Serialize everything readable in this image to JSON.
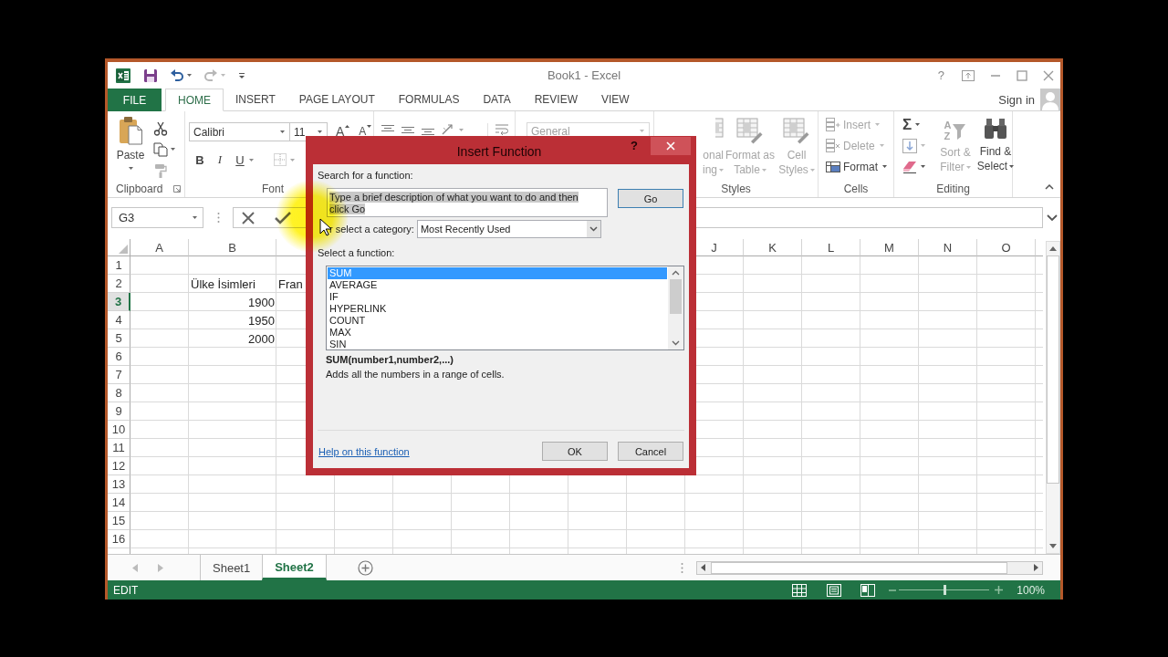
{
  "window": {
    "title": "Book1 - Excel",
    "help": "?"
  },
  "quick_access": [
    {
      "disabled": false
    },
    {
      "disabled": true
    }
  ],
  "tabs": [
    {
      "label": "FILE",
      "kind": "file",
      "selected": false
    },
    {
      "label": "HOME",
      "kind": "tab",
      "selected": true
    },
    {
      "label": "INSERT",
      "kind": "tab",
      "selected": false
    },
    {
      "label": "PAGE LAYOUT",
      "kind": "tab",
      "selected": false
    },
    {
      "label": "FORMULAS",
      "kind": "tab",
      "selected": false
    },
    {
      "label": "DATA",
      "kind": "tab",
      "selected": false
    },
    {
      "label": "REVIEW",
      "kind": "tab",
      "selected": false
    },
    {
      "label": "VIEW",
      "kind": "tab",
      "selected": false
    }
  ],
  "account": {
    "label": "Sign in"
  },
  "ribbon": {
    "clipboard": {
      "label": "Clipboard",
      "paste": "Paste",
      "small_buttons": [
        {
          "disabled": false
        },
        {
          "disabled": false
        },
        {
          "disabled": true
        }
      ]
    },
    "font": {
      "label": "Font",
      "font_name": "Calibri",
      "font_size": "11",
      "size_buttons": [
        "A",
        "A"
      ],
      "style_buttons": [
        "B",
        "I",
        "U"
      ]
    },
    "number": {
      "format": "General",
      "disabled": true
    },
    "styles": {
      "label": "Styles",
      "buttons": [
        {
          "kind": "partial",
          "lines": [
            "onal",
            "ing"
          ],
          "disabled": true
        },
        {
          "kind": "large",
          "lines": [
            "Format as",
            "Table"
          ],
          "disabled": true
        },
        {
          "kind": "large",
          "lines": [
            "Cell",
            "Styles"
          ],
          "disabled": true
        }
      ]
    },
    "cells": {
      "label": "Cells",
      "buttons": [
        {
          "label": "Insert",
          "disabled": true
        },
        {
          "label": "Delete",
          "disabled": true
        },
        {
          "label": "Format",
          "disabled": false
        }
      ]
    },
    "editing": {
      "label": "Editing",
      "small_buttons": [
        {
          "symbol": "Σ",
          "disabled": false
        },
        {
          "disabled": true
        },
        {
          "disabled": false
        }
      ],
      "sort_letters": [
        "A",
        "Z"
      ],
      "buttons": [
        {
          "lines": [
            "Sort &",
            "Filter"
          ],
          "disabled": true
        },
        {
          "lines": [
            "Find &",
            "Select"
          ],
          "disabled": false
        }
      ]
    }
  },
  "formula_bar": {
    "name_box": "G3"
  },
  "sheet": {
    "columns_left": [
      "A",
      "B"
    ],
    "columns_right": [
      "J",
      "K",
      "L",
      "M",
      "N",
      "O"
    ],
    "rows": [
      {
        "label": "1",
        "selected": false
      },
      {
        "label": "2",
        "selected": false,
        "cell_b": {
          "text": "Ülke İsimleri",
          "kind": "text"
        },
        "cell_c": {
          "text": "Fran",
          "kind": "text"
        }
      },
      {
        "label": "3",
        "selected": true,
        "cell_b": {
          "text": "1900",
          "kind": "number"
        }
      },
      {
        "label": "4",
        "selected": false,
        "cell_b": {
          "text": "1950",
          "kind": "number"
        }
      },
      {
        "label": "5",
        "selected": false,
        "cell_b": {
          "text": "2000",
          "kind": "number"
        }
      },
      {
        "label": "6",
        "selected": false
      },
      {
        "label": "7",
        "selected": false
      },
      {
        "label": "8",
        "selected": false
      },
      {
        "label": "9",
        "selected": false
      },
      {
        "label": "10",
        "selected": false
      },
      {
        "label": "11",
        "selected": false
      },
      {
        "label": "12",
        "selected": false
      },
      {
        "label": "13",
        "selected": false
      },
      {
        "label": "14",
        "selected": false
      },
      {
        "label": "15",
        "selected": false
      },
      {
        "label": "16",
        "selected": false
      }
    ]
  },
  "sheet_tabs": [
    {
      "label": "Sheet1",
      "selected": false
    },
    {
      "label": "Sheet2",
      "selected": true
    }
  ],
  "status_bar": {
    "mode": "EDIT",
    "zoom": "100%",
    "zoom_slider": {
      "level": 0.5
    }
  },
  "dialog": {
    "title": "Insert Function",
    "help": "?",
    "search_label": "Search for a function:",
    "search": {
      "value": "Type a brief description of what you want to do and then click Go",
      "selected": true
    },
    "go": "Go",
    "category_label": "r select a category:",
    "category": "Most Recently Used",
    "function_label": "Select a function:",
    "functions": [
      {
        "name": "SUM",
        "selected": true
      },
      {
        "name": "AVERAGE",
        "selected": false
      },
      {
        "name": "IF",
        "selected": false
      },
      {
        "name": "HYPERLINK",
        "selected": false
      },
      {
        "name": "COUNT",
        "selected": false
      },
      {
        "name": "MAX",
        "selected": false
      },
      {
        "name": "SIN",
        "selected": false
      }
    ],
    "signature": "SUM(number1,number2,...)",
    "description": "Adds all the numbers in a range of cells.",
    "help_link": "Help on this function",
    "buttons": [
      "OK",
      "Cancel"
    ]
  }
}
